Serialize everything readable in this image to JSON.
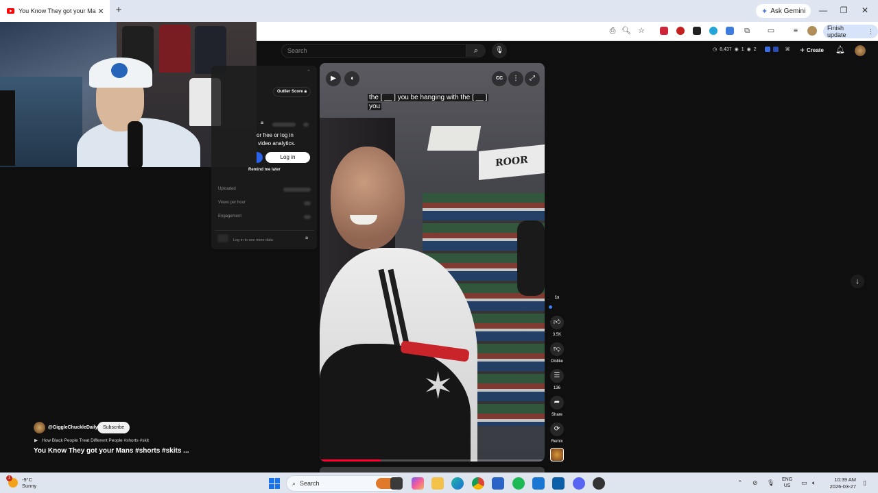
{
  "browser": {
    "tab_title": "You Know They got your Mans",
    "tab_close": "✕",
    "new_tab": "+",
    "ask_gemini": "Ask Gemini",
    "finish_update": "Finish update",
    "window_controls": [
      "—",
      "❐",
      "✕"
    ]
  },
  "youtube": {
    "search_placeholder": "Search",
    "stats": {
      "views": "8,437",
      "likes": "1",
      "comments": "2"
    },
    "create_label": "Create"
  },
  "analytics_panel": {
    "outlier_score": "Outlier Score",
    "promo_line_1": "or free or log in",
    "promo_line_2": "video analytics.",
    "login_button": "Log in",
    "remind_later": "Remind me later",
    "metrics": [
      "Uploaded",
      "Views per hour",
      "Engagement"
    ],
    "see_more": "Log in to see more data"
  },
  "video": {
    "caption_line_1": "the [ __ ] you be hanging with the [ __ ]",
    "caption_line_2": "you",
    "sign_text": "ROOR",
    "progress": 0.27
  },
  "action_rail": {
    "speed": "1x",
    "likes": "3.5K",
    "dislike": "Dislike",
    "comments": "136",
    "share": "Share",
    "remix": "Remix"
  },
  "short_info": {
    "channel": "@GiggleChuckleDaily",
    "subscribe": "Subscribe",
    "playlist": "How Black People Treat Different People #shorts #skit",
    "title": "You Know They got your Mans #shorts #skits  ..."
  },
  "taskbar": {
    "temperature": "-9°C",
    "condition": "Sunny",
    "weather_badge": "1",
    "search": "Search",
    "lang_1": "ENG",
    "lang_2": "US",
    "time": "10:39 AM",
    "date": "2026-03-27"
  }
}
